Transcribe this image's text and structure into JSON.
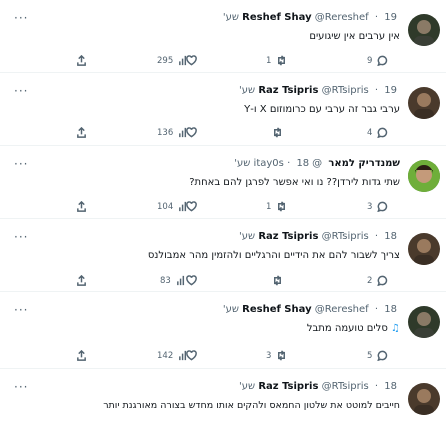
{
  "tweets": [
    {
      "name": "Reshef Shay",
      "handle": "@Rereshef",
      "time": "19 שע'",
      "text": "אין ערבים אין שיגועים",
      "views": "295",
      "likes": "",
      "retweets": "1",
      "replies": "9",
      "avatar_color": "#2f3a2a"
    },
    {
      "name": "Raz Tsipris",
      "handle": "@RTsipris",
      "time": "19 שע'",
      "text": "ערבי גבר זה ערבי עם כרומוזום X ו-Y",
      "views": "136",
      "likes": "",
      "retweets": "",
      "replies": "4",
      "avatar_color": "#4a3a2c"
    },
    {
      "name": "שמנדריק למאר",
      "handle": "@itay0s",
      "time": "18 שע'",
      "text": "שתי גדות לירדן?? נו ואי אפשר לפרגן להם באחת?",
      "views": "104",
      "likes": "",
      "retweets": "1",
      "replies": "3",
      "avatar_color": "#3c7a3a"
    },
    {
      "name": "Raz Tsipris",
      "handle": "@RTsipris",
      "time": "18 שע'",
      "text": "צריך לשבור להם את הידיים והרגליים ולהזמין מהר אמבולנס",
      "views": "83",
      "likes": "",
      "retweets": "",
      "replies": "2",
      "avatar_color": "#4a3a2c"
    },
    {
      "name": "Reshef Shay",
      "handle": "@Rereshef",
      "time": "18 שע'",
      "text": "סלים טועמה מתבל",
      "emoji": "♫",
      "views": "142",
      "likes": "",
      "retweets": "3",
      "replies": "5",
      "avatar_color": "#2f3a2a"
    },
    {
      "name": "Raz Tsipris",
      "handle": "@RTsipris",
      "time": "18 שע'",
      "text": "חייבים למוטט את שלטון החמאס ולהקים אותו מחדש בצורה מאורגנת יותר",
      "views": "",
      "likes": "",
      "retweets": "",
      "replies": "",
      "avatar_color": "#4a3a2c"
    }
  ],
  "more_label": "···"
}
